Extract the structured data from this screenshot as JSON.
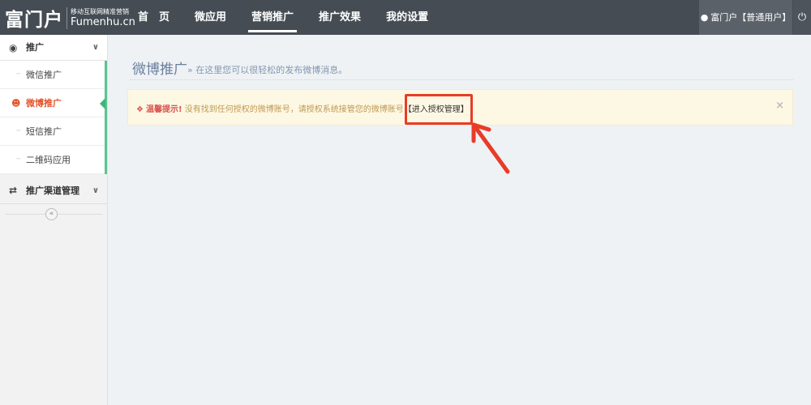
{
  "logo": {
    "main": "富门户",
    "tagline": "移动互联网精准营销",
    "domain": "Fumenhu.cn"
  },
  "nav": {
    "items": [
      {
        "label": "首　页"
      },
      {
        "label": "微应用"
      },
      {
        "label": "营销推广"
      },
      {
        "label": "推广效果"
      },
      {
        "label": "我的设置"
      }
    ],
    "active_index": 2
  },
  "user": {
    "label": "富门户【普通用户】",
    "icon": "user-icon",
    "power_icon": "power-icon"
  },
  "sidebar": {
    "group1": {
      "label": "推广",
      "icon": "comments-icon"
    },
    "items": [
      {
        "label": "微信推广"
      },
      {
        "label": "微博推广",
        "active": true,
        "icon": "users-icon"
      },
      {
        "label": "短信推广"
      },
      {
        "label": "二维码应用"
      }
    ],
    "group2": {
      "label": "推广渠道管理",
      "icon": "exchange-icon"
    },
    "collapse_icon": "double-chevron-left-icon"
  },
  "page": {
    "title": "微博推广",
    "description": "» 在这里您可以很轻松的发布微博消息。"
  },
  "alert": {
    "strong": "温馨提示!",
    "message": " 没有找到任何授权的微博账号，请授权系统接管您的微博账号",
    "link": "【进入授权管理】",
    "close": "×"
  },
  "colors": {
    "topbar": "#454c54",
    "accent_green": "#5ac590",
    "active_red": "#e2542c",
    "annotation_red": "#e73c28",
    "alert_bg": "#fdf8e3"
  }
}
